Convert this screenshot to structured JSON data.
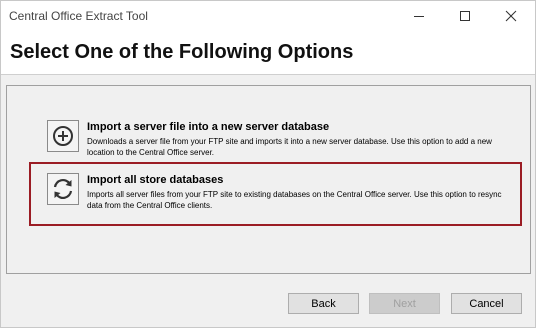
{
  "window": {
    "title": "Central Office Extract Tool"
  },
  "header": {
    "heading": "Select One of the Following Options"
  },
  "options": [
    {
      "icon": "plus-circle-icon",
      "title": "Import a server file into a new server database",
      "description": "Downloads a server file from your FTP site and imports it into a new server database. Use this option to add a new location to the Central Office server."
    },
    {
      "icon": "refresh-icon",
      "title": "Import all store databases",
      "description": "Imports all server files from your FTP site to existing databases on the Central Office server. Use this option to resync data from the Central Office clients.",
      "highlighted": true
    }
  ],
  "buttons": {
    "back": "Back",
    "next": "Next",
    "cancel": "Cancel"
  },
  "colors": {
    "highlight_border": "#9b1c24"
  }
}
